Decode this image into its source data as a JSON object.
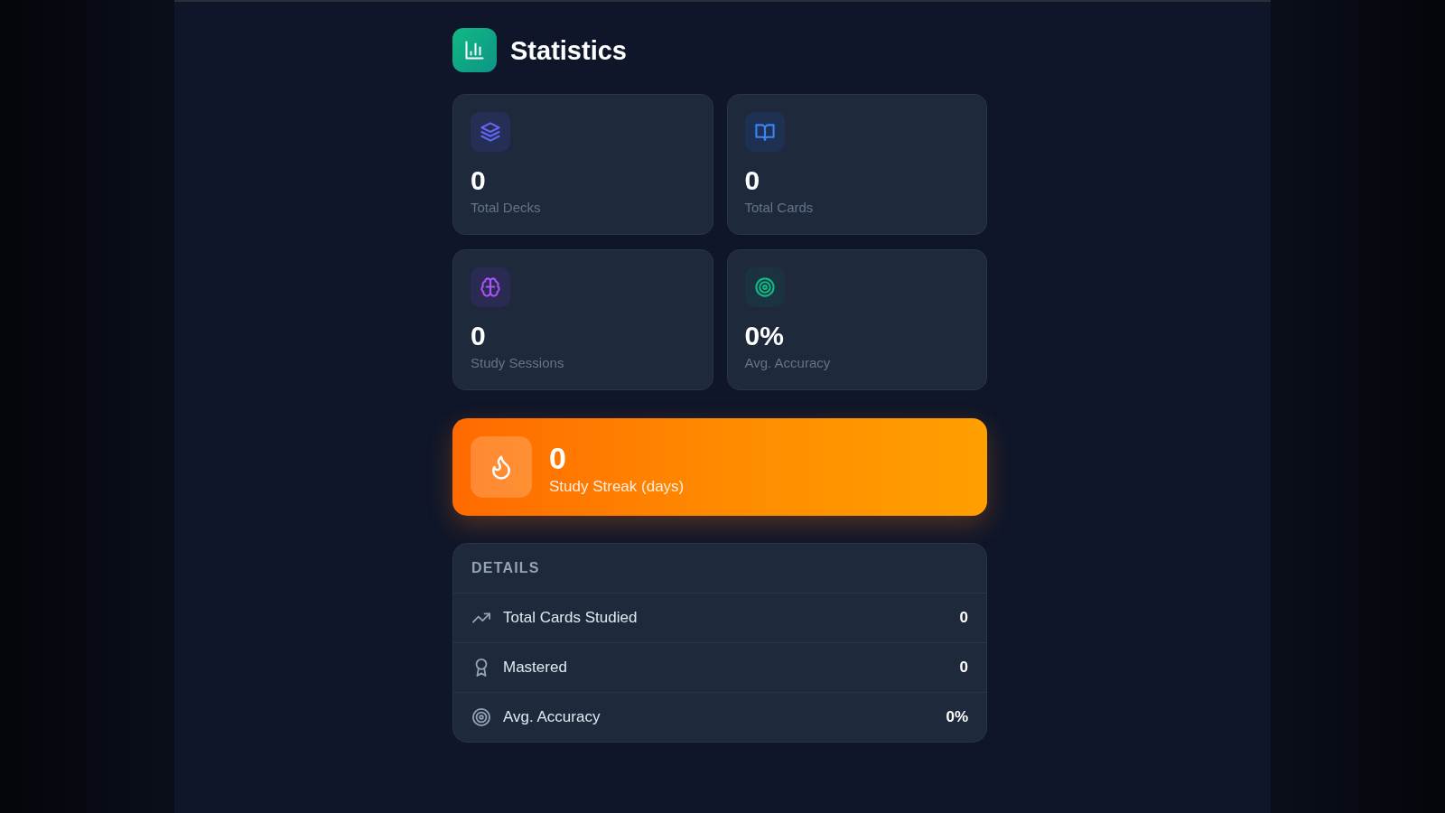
{
  "header": {
    "title": "Statistics"
  },
  "stat_cards": [
    {
      "kind": "layers",
      "value": "0",
      "label": "Total Decks"
    },
    {
      "kind": "book",
      "value": "0",
      "label": "Total Cards"
    },
    {
      "kind": "brain",
      "value": "0",
      "label": "Study Sessions"
    },
    {
      "kind": "target",
      "value": "0%",
      "label": "Avg. Accuracy"
    }
  ],
  "streak": {
    "value": "0",
    "label": "Study Streak (days)"
  },
  "details": {
    "title": "DETAILS",
    "rows": [
      {
        "kind": "trend",
        "label": "Total Cards Studied",
        "value": "0"
      },
      {
        "kind": "award",
        "label": "Mastered",
        "value": "0"
      },
      {
        "kind": "target",
        "label": "Avg. Accuracy",
        "value": "0%"
      }
    ]
  }
}
